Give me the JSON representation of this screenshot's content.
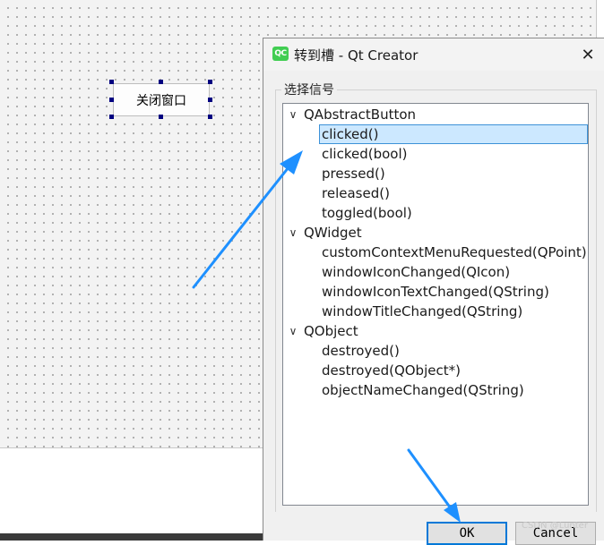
{
  "form": {
    "button_label": "关闭窗口"
  },
  "dialog": {
    "icon_text": "QC",
    "title": "转到槽 - Qt Creator",
    "close_glyph": "✕",
    "group_label": "选择信号",
    "ok_label": "OK",
    "cancel_label": "Cancel"
  },
  "tree": {
    "expand_glyph": "∨",
    "groups": [
      {
        "name": "QAbstractButton",
        "signals": [
          "clicked()",
          "clicked(bool)",
          "pressed()",
          "released()",
          "toggled(bool)"
        ]
      },
      {
        "name": "QWidget",
        "signals": [
          "customContextMenuRequested(QPoint)",
          "windowIconChanged(QIcon)",
          "windowIconTextChanged(QString)",
          "windowTitleChanged(QString)"
        ]
      },
      {
        "name": "QObject",
        "signals": [
          "destroyed()",
          "destroyed(QObject*)",
          "objectNameChanged(QString)"
        ]
      }
    ],
    "selected": "clicked()"
  },
  "watermark": "CSDN @Lunter",
  "colors": {
    "selection_fill": "#cce8ff",
    "selection_border": "#3d92d8",
    "annotation_arrow": "#1e90ff",
    "qt_green": "#41cd52"
  }
}
